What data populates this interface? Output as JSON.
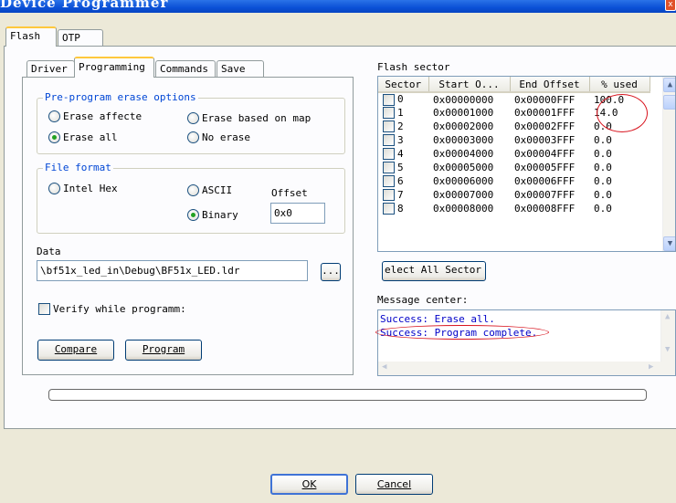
{
  "window": {
    "title": "Device Programmer",
    "close_glyph": "x"
  },
  "outer_tabs": [
    {
      "label": "Flash"
    },
    {
      "label": "OTP"
    }
  ],
  "inner_tabs": [
    {
      "label": "Driver"
    },
    {
      "label": "Programming"
    },
    {
      "label": "Commands"
    },
    {
      "label": "Save"
    }
  ],
  "preprogram": {
    "legend": "Pre-program erase options",
    "options": [
      {
        "label": "Erase affecte",
        "selected": false
      },
      {
        "label": "Erase based on map",
        "selected": false
      },
      {
        "label": "Erase all",
        "selected": true
      },
      {
        "label": "No erase",
        "selected": false
      }
    ]
  },
  "file_format": {
    "legend": "File format",
    "options": [
      {
        "label": "Intel Hex",
        "selected": false
      },
      {
        "label": "ASCII",
        "selected": false
      },
      {
        "label": "Binary",
        "selected": true
      }
    ],
    "offset_label": "Offset",
    "offset_value": "0x0"
  },
  "data": {
    "label": "Data",
    "path": "\\bf51x_led_in\\Debug\\BF51x_LED.ldr",
    "browse_label": "..."
  },
  "verify": {
    "label": "Verify while programm:",
    "checked": false
  },
  "buttons": {
    "compare": "Compare",
    "program": "Program",
    "ok": "OK",
    "cancel": "Cancel"
  },
  "flash_sector": {
    "label": "Flash sector",
    "columns": [
      "Sector",
      "Start O...",
      "End Offset",
      "% used"
    ],
    "rows": [
      {
        "sector": "0",
        "start": "0x00000000",
        "end": "0x00000FFF",
        "used": "100.0"
      },
      {
        "sector": "1",
        "start": "0x00001000",
        "end": "0x00001FFF",
        "used": "14.0"
      },
      {
        "sector": "2",
        "start": "0x00002000",
        "end": "0x00002FFF",
        "used": "0.0"
      },
      {
        "sector": "3",
        "start": "0x00003000",
        "end": "0x00003FFF",
        "used": "0.0"
      },
      {
        "sector": "4",
        "start": "0x00004000",
        "end": "0x00004FFF",
        "used": "0.0"
      },
      {
        "sector": "5",
        "start": "0x00005000",
        "end": "0x00005FFF",
        "used": "0.0"
      },
      {
        "sector": "6",
        "start": "0x00006000",
        "end": "0x00006FFF",
        "used": "0.0"
      },
      {
        "sector": "7",
        "start": "0x00007000",
        "end": "0x00007FFF",
        "used": "0.0"
      },
      {
        "sector": "8",
        "start": "0x00008000",
        "end": "0x00008FFF",
        "used": "0.0"
      }
    ],
    "select_all_label": "elect All Sector"
  },
  "message_center": {
    "label": "Message center:",
    "messages": [
      "Success: Erase all.",
      "Success: Program complete."
    ]
  },
  "progress": {
    "value": 0
  },
  "colors": {
    "annotation": "#d8141e",
    "message_text": "#0000c8",
    "titlebar": "#0a50d6"
  }
}
